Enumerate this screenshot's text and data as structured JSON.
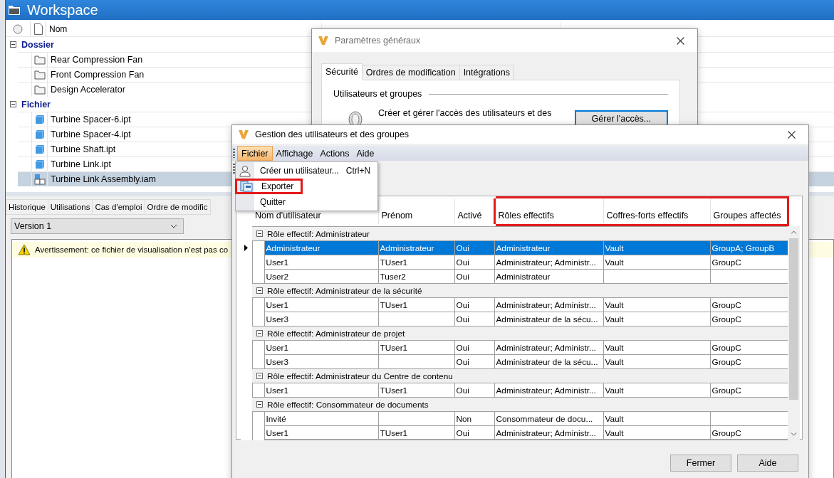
{
  "workspace": {
    "title": "Workspace",
    "columns": [
      {
        "label": "Nom"
      }
    ],
    "groups": [
      {
        "label": "Dossier",
        "expanded": true,
        "items": [
          {
            "name": "Rear Compression Fan",
            "kind": "folder",
            "selected": false
          },
          {
            "name": "Front Compression Fan",
            "kind": "folder",
            "selected": false
          },
          {
            "name": "Design Accelerator",
            "kind": "folder",
            "selected": false
          }
        ]
      },
      {
        "label": "Fichier",
        "expanded": true,
        "items": [
          {
            "name": "Turbine Spacer-6.ipt",
            "kind": "part",
            "selected": false
          },
          {
            "name": "Turbine Spacer-4.ipt",
            "kind": "part",
            "selected": false
          },
          {
            "name": "Turbine Shaft.ipt",
            "kind": "part",
            "selected": false
          },
          {
            "name": "Turbine Link.ipt",
            "kind": "part",
            "selected": false
          },
          {
            "name": "Turbine Link Assembly.iam",
            "kind": "assembly",
            "selected": true
          }
        ]
      }
    ],
    "tabs": [
      {
        "label": "Historique",
        "selected": false
      },
      {
        "label": "Utilisations",
        "selected": false
      },
      {
        "label": "Cas d'emploi",
        "selected": false
      },
      {
        "label": "Ordre de modific",
        "selected": false
      }
    ],
    "version": {
      "value": "Version 1"
    },
    "warning": "Avertissement: ce fichier de visualisation n'est pas co"
  },
  "general_settings": {
    "title": "Paramètres généraux",
    "tabs": [
      {
        "label": "Sécurité",
        "selected": true
      },
      {
        "label": "Ordres de modification",
        "selected": false
      },
      {
        "label": "Intégrations",
        "selected": false
      }
    ],
    "section": "Utilisateurs et groupes",
    "description": "Créer et gérer l'accès des utilisateurs et des",
    "button": "Gérer l'accès..."
  },
  "user_dialog": {
    "title": "Gestion des utilisateurs et des groupes",
    "menu": [
      {
        "label": "Fichier",
        "selected": true
      },
      {
        "label": "Affichage",
        "selected": false
      },
      {
        "label": "Actions",
        "selected": false
      },
      {
        "label": "Aide",
        "selected": false
      }
    ],
    "file_menu": [
      {
        "label": "Créer un utilisateur...",
        "shortcut": "Ctrl+N",
        "kind": "user",
        "highlighted": false
      },
      {
        "label": "Exporter",
        "kind": "export",
        "highlighted": true
      },
      {
        "label": "Quitter",
        "kind": "plain",
        "highlighted": false
      }
    ],
    "columns": [
      {
        "label": "Nom d'utilisateur",
        "highlighted": false
      },
      {
        "label": "Prénom",
        "highlighted": false
      },
      {
        "label": "Activé",
        "highlighted": false
      },
      {
        "label": "Rôles effectifs",
        "highlighted": true
      },
      {
        "label": "Coffres-forts effectifs",
        "highlighted": true
      },
      {
        "label": "Groupes affectés",
        "highlighted": true
      }
    ],
    "groups": [
      {
        "label": "Rôle effectif: Administrateur",
        "expanded": true,
        "rows": [
          {
            "cells": [
              "Administrateur",
              "Administrateur",
              "Oui",
              "Administrateur",
              "Vault",
              "GroupA; GroupB"
            ],
            "selected": true
          },
          {
            "cells": [
              "User1",
              "TUser1",
              "Oui",
              "Administrateur; Administr...",
              "Vault",
              "GroupC"
            ],
            "selected": false
          },
          {
            "cells": [
              "User2",
              "Tuser2",
              "Oui",
              "Administrateur",
              "",
              ""
            ],
            "selected": false
          }
        ]
      },
      {
        "label": "Rôle effectif: Administrateur de la sécurité",
        "expanded": true,
        "rows": [
          {
            "cells": [
              "User1",
              "TUser1",
              "Oui",
              "Administrateur; Administr...",
              "Vault",
              "GroupC"
            ],
            "selected": false
          },
          {
            "cells": [
              "User3",
              "",
              "Oui",
              "Administrateur de la sécu...",
              "Vault",
              "GroupC"
            ],
            "selected": false
          }
        ]
      },
      {
        "label": "Rôle effectif: Administrateur de projet",
        "expanded": true,
        "rows": [
          {
            "cells": [
              "User1",
              "TUser1",
              "Oui",
              "Administrateur; Administr...",
              "Vault",
              "GroupC"
            ],
            "selected": false
          },
          {
            "cells": [
              "User3",
              "",
              "Oui",
              "Administrateur de la sécu...",
              "Vault",
              "GroupC"
            ],
            "selected": false
          }
        ]
      },
      {
        "label": "Rôle effectif: Administrateur du Centre de contenu",
        "expanded": true,
        "rows": [
          {
            "cells": [
              "User1",
              "TUser1",
              "Oui",
              "Administrateur; Administr...",
              "Vault",
              "GroupC"
            ],
            "selected": false
          }
        ]
      },
      {
        "label": "Rôle effectif: Consommateur de documents",
        "expanded": true,
        "rows": [
          {
            "cells": [
              "Invité",
              "",
              "Non",
              "Consommateur de docu...",
              "Vault",
              ""
            ],
            "selected": false
          },
          {
            "cells": [
              "User1",
              "TUser1",
              "Oui",
              "Administrateur; Administr...",
              "Vault",
              "GroupC"
            ],
            "selected": false
          }
        ]
      }
    ],
    "buttons": [
      "Fermer",
      "Aide"
    ]
  }
}
